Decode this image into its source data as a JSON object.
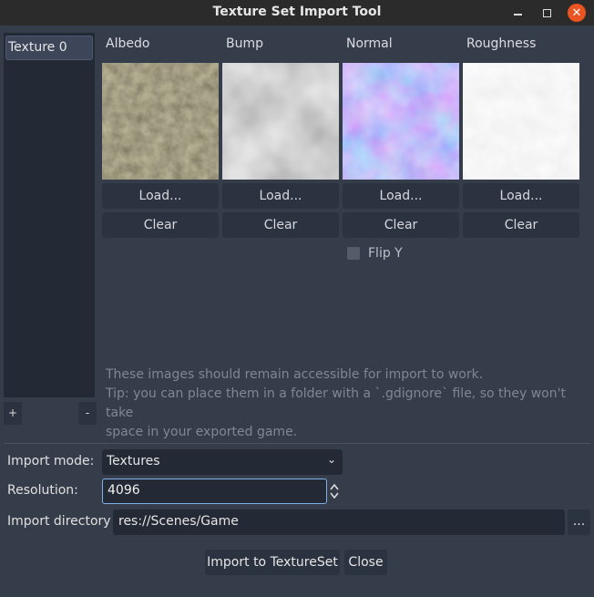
{
  "window": {
    "title": "Texture Set Import Tool"
  },
  "texture_list": {
    "items": [
      {
        "label": "Texture 0"
      }
    ],
    "add_label": "+",
    "remove_label": "-"
  },
  "columns": [
    {
      "label": "Albedo",
      "load_label": "Load...",
      "clear_label": "Clear"
    },
    {
      "label": "Bump",
      "load_label": "Load...",
      "clear_label": "Clear"
    },
    {
      "label": "Normal",
      "load_label": "Load...",
      "clear_label": "Clear"
    },
    {
      "label": "Roughness",
      "load_label": "Load...",
      "clear_label": "Clear"
    }
  ],
  "flip_y": {
    "label": "Flip Y",
    "checked": false
  },
  "hint_lines": [
    "These images should remain accessible for import to work.",
    "Tip: you can place them in a folder with a `.gdignore` file, so they won't take",
    "space in your exported game."
  ],
  "import_mode": {
    "label": "Import mode:",
    "value": "Textures"
  },
  "resolution": {
    "label": "Resolution:",
    "value": "4096"
  },
  "import_directory": {
    "label": "Import directory",
    "value": "res://Scenes/Game",
    "browse_label": "..."
  },
  "actions": {
    "import_label": "Import to TextureSet",
    "close_label": "Close"
  },
  "colors": {
    "accent": "#7fb0e8",
    "close_button": "#e95420",
    "background": "#363d4a",
    "panel": "#232935"
  },
  "icons": {
    "minimize": "minimize-icon",
    "maximize": "maximize-icon",
    "close": "close-icon",
    "dropdown": "chevron-down-icon",
    "spin": "updown-arrows-icon"
  }
}
